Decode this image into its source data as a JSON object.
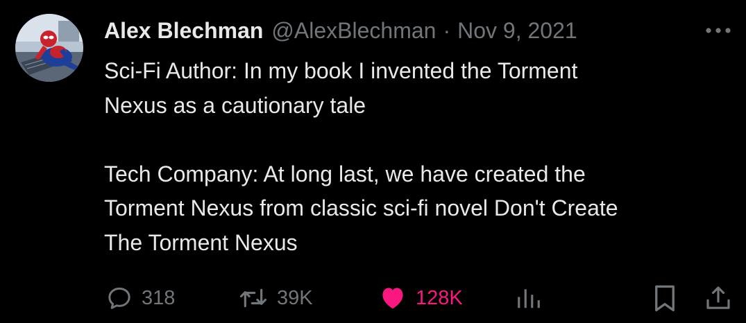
{
  "author": {
    "display_name": "Alex Blechman",
    "handle": "@AlexBlechman",
    "separator": "·",
    "date": "Nov 9, 2021",
    "avatar_icon": "spider-man-avatar"
  },
  "tweet": {
    "paragraphs": [
      "Sci-Fi Author: In my book I invented the Torment\nNexus as a cautionary tale",
      "Tech Company: At long last, we have created the\nTorment Nexus from classic sci-fi novel Don't Create\nThe Torment Nexus"
    ]
  },
  "actions": {
    "reply": {
      "icon": "reply-bubble-icon",
      "count": "318"
    },
    "retweet": {
      "icon": "retweet-icon",
      "count": "39K"
    },
    "like": {
      "icon": "heart-icon",
      "count": "128K",
      "liked": true,
      "color": "#f91880"
    },
    "views": {
      "icon": "views-bar-icon"
    },
    "bookmark": {
      "icon": "bookmark-icon"
    },
    "share": {
      "icon": "share-icon"
    }
  },
  "colors": {
    "background": "#000000",
    "primary_text": "#e7e9ea",
    "secondary_text": "#71767b",
    "like_accent": "#f91880"
  }
}
